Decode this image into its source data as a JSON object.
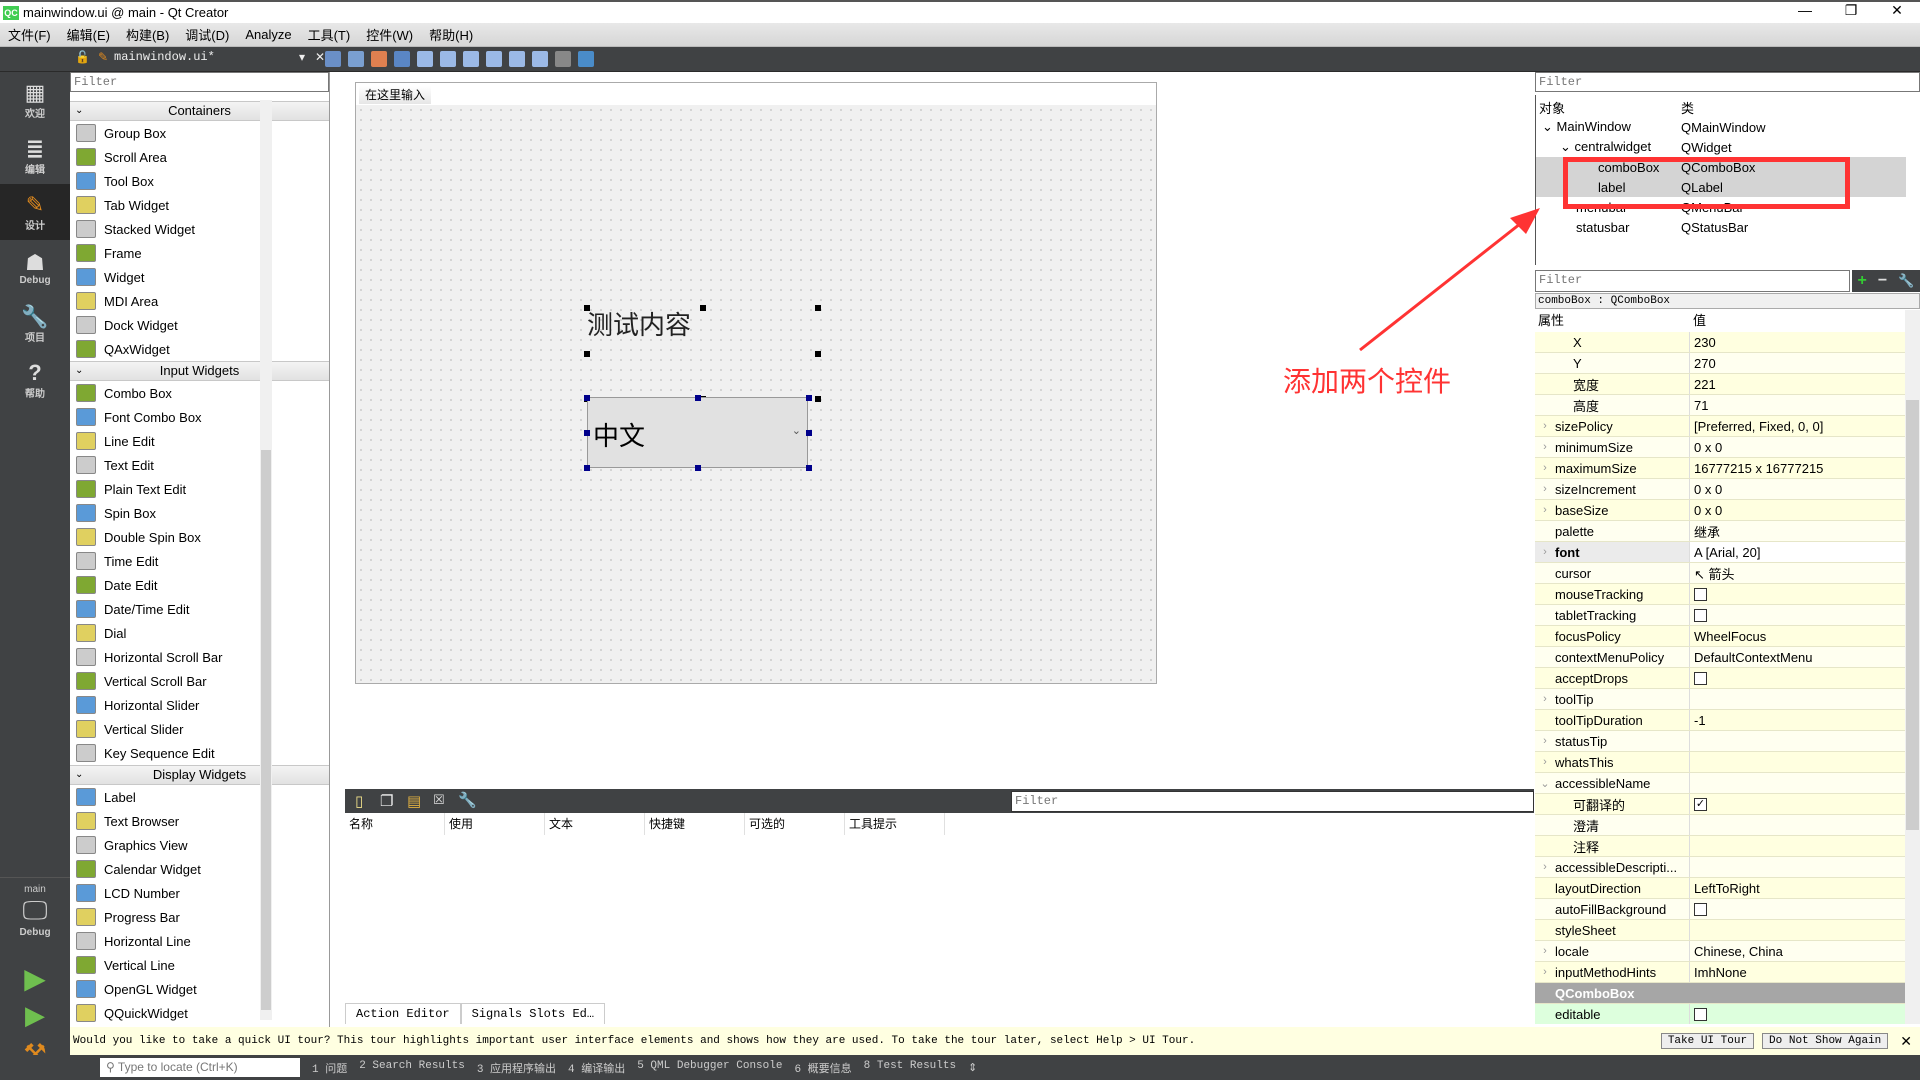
{
  "window": {
    "title": "mainwindow.ui @ main - Qt Creator",
    "logo": "QC",
    "controls": [
      "—",
      "❐",
      "✕"
    ]
  },
  "menu": [
    "文件(F)",
    "编辑(E)",
    "构建(B)",
    "调试(D)",
    "Analyze",
    "工具(T)",
    "控件(W)",
    "帮助(H)"
  ],
  "toolbar": {
    "document": "mainwindow.ui*",
    "close": "✕"
  },
  "modes": [
    {
      "label": "欢迎",
      "icon": "▦"
    },
    {
      "label": "编辑",
      "icon": "≣"
    },
    {
      "label": "设计",
      "icon": "✎"
    },
    {
      "label": "Debug",
      "icon": "☗"
    },
    {
      "label": "项目",
      "icon": "🔧"
    },
    {
      "label": "帮助",
      "icon": "?"
    }
  ],
  "kit": {
    "project": "main",
    "config": "Debug"
  },
  "widgetbox": {
    "filter_placeholder": "Filter",
    "categories": [
      {
        "name": "Containers",
        "items": [
          "Group Box",
          "Scroll Area",
          "Tool Box",
          "Tab Widget",
          "Stacked Widget",
          "Frame",
          "Widget",
          "MDI Area",
          "Dock Widget",
          "QAxWidget"
        ]
      },
      {
        "name": "Input Widgets",
        "items": [
          "Combo Box",
          "Font Combo Box",
          "Line Edit",
          "Text Edit",
          "Plain Text Edit",
          "Spin Box",
          "Double Spin Box",
          "Time Edit",
          "Date Edit",
          "Date/Time Edit",
          "Dial",
          "Horizontal Scroll Bar",
          "Vertical Scroll Bar",
          "Horizontal Slider",
          "Vertical Slider",
          "Key Sequence Edit"
        ]
      },
      {
        "name": "Display Widgets",
        "items": [
          "Label",
          "Text Browser",
          "Graphics View",
          "Calendar Widget",
          "LCD Number",
          "Progress Bar",
          "Horizontal Line",
          "Vertical Line",
          "OpenGL Widget",
          "QQuickWidget"
        ]
      }
    ]
  },
  "form": {
    "menu_placeholder": "在这里输入",
    "label_text": "测试内容",
    "combo_value": "中文"
  },
  "action_editor": {
    "filter_placeholder": "Filter",
    "columns": [
      "名称",
      "使用",
      "文本",
      "快捷键",
      "可选的",
      "工具提示"
    ],
    "tabs": [
      "Action Editor",
      "Signals  Slots Ed…"
    ]
  },
  "object_inspector": {
    "filter_placeholder": "Filter",
    "col_object": "对象",
    "col_class": "类",
    "rows": [
      {
        "name": "MainWindow",
        "class": "QMainWindow",
        "depth": 0,
        "expanded": true
      },
      {
        "name": "centralwidget",
        "class": "QWidget",
        "depth": 1,
        "expanded": true
      },
      {
        "name": "comboBox",
        "class": "QComboBox",
        "depth": 2,
        "selected": true
      },
      {
        "name": "label",
        "class": "QLabel",
        "depth": 2,
        "selected": true
      },
      {
        "name": "menubar",
        "class": "QMenuBar",
        "depth": 1
      },
      {
        "name": "statusbar",
        "class": "QStatusBar",
        "depth": 1
      }
    ]
  },
  "property_editor": {
    "filter_placeholder": "Filter",
    "current": "comboBox : QComboBox",
    "col_property": "属性",
    "col_value": "值",
    "rows": [
      {
        "k": "X",
        "v": "230",
        "indent": 2
      },
      {
        "k": "Y",
        "v": "270",
        "indent": 2
      },
      {
        "k": "宽度",
        "v": "221",
        "indent": 2
      },
      {
        "k": "高度",
        "v": "71",
        "indent": 2
      },
      {
        "k": "sizePolicy",
        "v": "[Preferred, Fixed, 0, 0]",
        "exp": ">"
      },
      {
        "k": "minimumSize",
        "v": "0 x 0",
        "exp": ">"
      },
      {
        "k": "maximumSize",
        "v": "16777215 x 16777215",
        "exp": ">"
      },
      {
        "k": "sizeIncrement",
        "v": "0 x 0",
        "exp": ">"
      },
      {
        "k": "baseSize",
        "v": "0 x 0",
        "exp": ">"
      },
      {
        "k": "palette",
        "v": "继承"
      },
      {
        "k": "font",
        "v": "A [Arial, 20]",
        "exp": ">",
        "bold": true
      },
      {
        "k": "cursor",
        "v": "↖ 箭头"
      },
      {
        "k": "mouseTracking",
        "cb": false
      },
      {
        "k": "tabletTracking",
        "cb": false
      },
      {
        "k": "focusPolicy",
        "v": "WheelFocus"
      },
      {
        "k": "contextMenuPolicy",
        "v": "DefaultContextMenu"
      },
      {
        "k": "acceptDrops",
        "cb": false
      },
      {
        "k": "toolTip",
        "v": "",
        "exp": ">"
      },
      {
        "k": "toolTipDuration",
        "v": "-1"
      },
      {
        "k": "statusTip",
        "v": "",
        "exp": ">"
      },
      {
        "k": "whatsThis",
        "v": "",
        "exp": ">"
      },
      {
        "k": "accessibleName",
        "v": "",
        "exp": "v"
      },
      {
        "k": "可翻译的",
        "cb": true,
        "indent": 2
      },
      {
        "k": "澄清",
        "v": "",
        "indent": 2
      },
      {
        "k": "注释",
        "v": "",
        "indent": 2
      },
      {
        "k": "accessibleDescripti...",
        "v": "",
        "exp": ">"
      },
      {
        "k": "layoutDirection",
        "v": "LeftToRight"
      },
      {
        "k": "autoFillBackground",
        "cb": false
      },
      {
        "k": "styleSheet",
        "v": ""
      },
      {
        "k": "locale",
        "v": "Chinese, China",
        "exp": ">"
      },
      {
        "k": "inputMethodHints",
        "v": "ImhNone",
        "exp": ">"
      },
      {
        "k": "QComboBox",
        "header": true
      },
      {
        "k": "editable",
        "cb": false,
        "green": true
      }
    ]
  },
  "tour": {
    "message": "Would you like to take a quick UI tour? This tour highlights important user interface elements and shows how they are used. To take the tour later, select Help > UI Tour.",
    "take": "Take UI Tour",
    "dismiss": "Do Not Show Again"
  },
  "statusbar": {
    "locator_placeholder": "Type to locate (Ctrl+K)",
    "panes": [
      "1 问题",
      "2 Search Results",
      "3 应用程序输出",
      "4 编译输出",
      "5 QML Debugger Console",
      "6 概要信息",
      "8 Test Results"
    ]
  },
  "annotation": {
    "text": "添加两个控件",
    "color": "#ff3333"
  }
}
